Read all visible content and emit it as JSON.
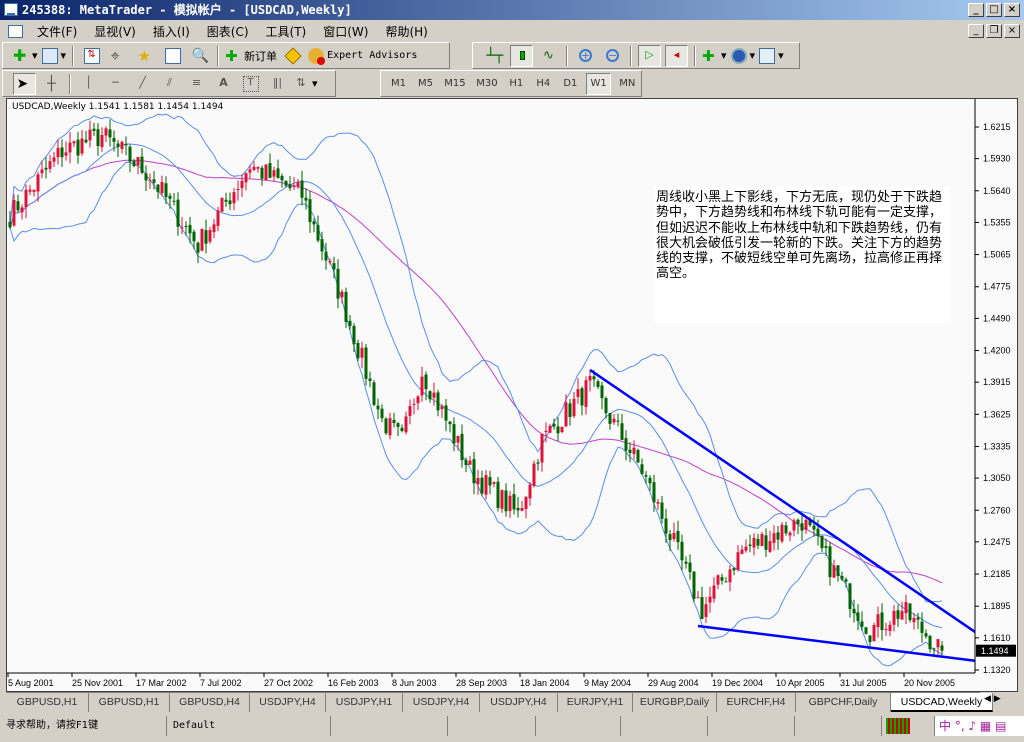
{
  "window": {
    "title": "245388: MetaTrader - 模拟帐户 - [USDCAD,Weekly]"
  },
  "menu": [
    "文件(F)",
    "显视(V)",
    "插入(I)",
    "图表(C)",
    "工具(T)",
    "窗口(W)",
    "帮助(H)"
  ],
  "toolbar": {
    "new_order": "新订单",
    "expert_advisors": "Expert Advisors"
  },
  "timeframes": [
    "M1",
    "M5",
    "M15",
    "M30",
    "H1",
    "H4",
    "D1",
    "W1",
    "MN"
  ],
  "active_timeframe": "W1",
  "chart": {
    "symbol_line": "USDCAD,Weekly  1.1541 1.1581 1.1454 1.1494",
    "annotation": "周线收小黑上下影线，下方无底，现仍处于下跌趋势中，下方趋势线和布林线下轨可能有一定支撑，但如迟迟不能收上布林线中轨和下跌趋势线，仍有很大机会破低引发一轮新的下跌。关注下方的趋势线的支撑，不破短线空单可先离场，拉高修正再择高空。",
    "current_price": "1.1494"
  },
  "chart_data": {
    "type": "candlestick",
    "symbol": "USDCAD",
    "period": "Weekly",
    "ylim": [
      1.132,
      1.6215
    ],
    "price_ticks": [
      "1.6215",
      "1.5930",
      "1.5640",
      "1.5355",
      "1.5065",
      "1.4775",
      "1.4490",
      "1.4200",
      "1.3915",
      "1.3625",
      "1.3335",
      "1.3050",
      "1.2760",
      "1.2475",
      "1.2185",
      "1.1895",
      "1.1610",
      "1.1320"
    ],
    "time_ticks": [
      {
        "bar": 0,
        "label": "5 Aug 2001"
      },
      {
        "bar": 16,
        "label": "25 Nov 2001"
      },
      {
        "bar": 32,
        "label": "17 Mar 2002"
      },
      {
        "bar": 48,
        "label": "7 Jul 2002"
      },
      {
        "bar": 64,
        "label": "27 Oct 2002"
      },
      {
        "bar": 80,
        "label": "16 Feb 2003"
      },
      {
        "bar": 96,
        "label": "8 Jun 2003"
      },
      {
        "bar": 112,
        "label": "28 Sep 2003"
      },
      {
        "bar": 128,
        "label": "18 Jan 2004"
      },
      {
        "bar": 144,
        "label": "9 May 2004"
      },
      {
        "bar": 160,
        "label": "29 Aug 2004"
      },
      {
        "bar": 176,
        "label": "19 Dec 2004"
      },
      {
        "bar": 192,
        "label": "10 Apr 2005"
      },
      {
        "bar": 208,
        "label": "31 Jul 2005"
      },
      {
        "bar": 224,
        "label": "20 Nov 2005"
      }
    ],
    "close_path": [
      [
        0,
        1.542
      ],
      [
        13,
        1.6
      ],
      [
        23,
        1.614
      ],
      [
        35,
        1.578
      ],
      [
        47,
        1.515
      ],
      [
        60,
        1.587
      ],
      [
        73,
        1.56
      ],
      [
        83,
        1.466
      ],
      [
        93,
        1.357
      ],
      [
        98,
        1.339
      ],
      [
        103,
        1.402
      ],
      [
        115,
        1.312
      ],
      [
        127,
        1.272
      ],
      [
        133,
        1.339
      ],
      [
        145,
        1.389
      ],
      [
        158,
        1.312
      ],
      [
        173,
        1.186
      ],
      [
        183,
        1.24
      ],
      [
        198,
        1.267
      ],
      [
        215,
        1.168
      ],
      [
        223,
        1.186
      ],
      [
        233,
        1.1494
      ]
    ],
    "last_bar": {
      "open": 1.1541,
      "high": 1.1581,
      "low": 1.1454,
      "close": 1.1494
    },
    "indicators": [
      {
        "name": "Bollinger Bands",
        "period": 20,
        "deviation": 2,
        "color": "#5a8ee8"
      },
      {
        "name": "Moving Average",
        "period": 50,
        "color": "#c040c8"
      }
    ],
    "trendlines": [
      {
        "name": "downtrend",
        "from": [
          145,
          1.4025
        ],
        "to": [
          242,
          1.1645
        ],
        "color": "#0000ff"
      },
      {
        "name": "support",
        "from": [
          172,
          1.1717
        ],
        "to": [
          242,
          1.14
        ],
        "color": "#0000ff"
      }
    ],
    "colors": {
      "bull": "#dc143c",
      "bear": "#006400",
      "background": "#fafafa"
    }
  },
  "tabs": [
    "GBPUSD,H1",
    "GBPUSD,H1",
    "GBPUSD,H4",
    "USDJPY,H4",
    "USDJPY,H1",
    "USDJPY,H4",
    "USDJPY,H4",
    "EURJPY,H1",
    "EURGBP,Daily",
    "EURCHF,H4",
    "GBPCHF,Daily",
    "USDCAD,Weekly"
  ],
  "active_tab": "USDCAD,Weekly",
  "status": {
    "help": "寻求帮助，请按F1键",
    "profile": "Default"
  }
}
